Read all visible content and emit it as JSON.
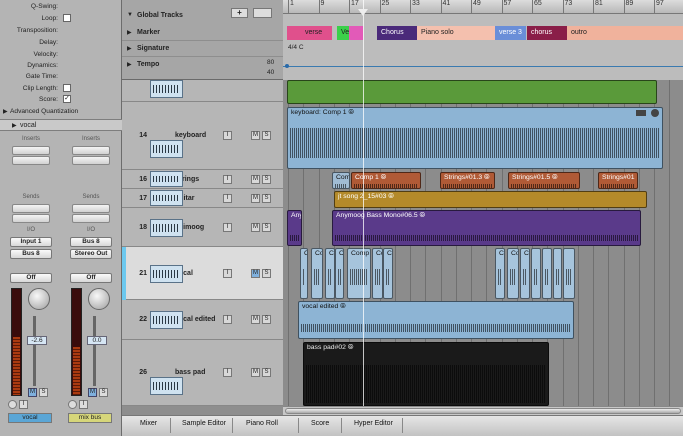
{
  "inspector": {
    "params": [
      {
        "label": "Q-Swing:",
        "value": "",
        "type": "value"
      },
      {
        "label": "Loop:",
        "value": "",
        "type": "check"
      },
      {
        "label": "Transposition:",
        "value": "",
        "type": "stepper"
      },
      {
        "label": "Delay:",
        "value": "",
        "type": "stepper"
      },
      {
        "label": "Velocity:",
        "value": "",
        "type": "value"
      },
      {
        "label": "Dynamics:",
        "value": "",
        "type": "stepper"
      },
      {
        "label": "Gate Time:",
        "value": "",
        "type": "stepper"
      },
      {
        "label": "Clip Length:",
        "value": "",
        "type": "check"
      },
      {
        "label": "Score:",
        "value": "✓",
        "type": "check"
      }
    ],
    "advanced_quantization": "Advanced Quantization",
    "region_name": "vocal",
    "strips": [
      {
        "inserts": "Inserts",
        "sends": "Sends",
        "io": "I/O",
        "input": "Input 1",
        "output": "Bus 8",
        "auto": "Off",
        "fader_value": "-2.6",
        "meter_level": 0.55,
        "name": "vocal",
        "name_color": "#5aa6d6"
      },
      {
        "inserts": "Inserts",
        "sends": "Sends",
        "io": "I/O",
        "input": "Bus 8",
        "output": "Stereo Out",
        "auto": "Off",
        "fader_value": "0.0",
        "meter_level": 0.45,
        "name": "mix bus",
        "name_color": "#d6d67a"
      }
    ]
  },
  "global": {
    "title": "Global Tracks",
    "rows": [
      "Marker",
      "Signature",
      "Tempo"
    ],
    "tempo_hi": "80",
    "tempo_lo": "40",
    "signature": "4/4  C"
  },
  "ruler": [
    "1",
    "9",
    "17",
    "25",
    "33",
    "41",
    "49",
    "57",
    "65",
    "73",
    "81",
    "89",
    "97"
  ],
  "markers": [
    {
      "name": "verse",
      "color": "#e0508c"
    },
    {
      "name": "Verse",
      "color": "#3bd04a"
    },
    {
      "name": "",
      "color": "#e25ab8"
    },
    {
      "name": "Chorus",
      "color": "#4a2a7a"
    },
    {
      "name": "Piano solo",
      "color": "#f4c0ae"
    },
    {
      "name": "verse 3",
      "color": "#6a8ed8"
    },
    {
      "name": "chorus",
      "color": "#8a1e48"
    },
    {
      "name": "outro",
      "color": "#f0b29c"
    }
  ],
  "tracks": [
    {
      "num": "",
      "name": "",
      "mute": false
    },
    {
      "num": "14",
      "name": "keyboard",
      "mute": false
    },
    {
      "num": "16",
      "name": "Strings",
      "mute": false
    },
    {
      "num": "17",
      "name": "guitar",
      "mute": false
    },
    {
      "num": "18",
      "name": "animoog",
      "mute": false
    },
    {
      "num": "21",
      "name": "vocal",
      "mute": true
    },
    {
      "num": "22",
      "name": "vocal edited",
      "mute": false
    },
    {
      "num": "26",
      "name": "bass pad",
      "mute": false
    }
  ],
  "regions": {
    "keyboard": "keyboard: Comp 1 ⦾",
    "strings": [
      "Com",
      "Comp 1 ⦾",
      "Strings#01.3 ⦾",
      "Strings#01.5 ⦾",
      "Strings#01"
    ],
    "guitar": "jt song 2_15#03 ⦾",
    "animoog_a": "Any",
    "animoog_b": "Anymoog Bass Mono#06.5 ⦾",
    "vocal": [
      "C",
      "Co",
      "C",
      "Comp",
      "Comp",
      "Co",
      "Co",
      "Co",
      "Co",
      "Co"
    ],
    "vocal_edited": "vocal edited ⦾",
    "bass_pad": "bass pad#02 ⦾"
  },
  "tabs": [
    "Mixer",
    "Sample Editor",
    "Piano Roll",
    "Score",
    "Hyper Editor"
  ],
  "buttons": {
    "mute": "M",
    "solo": "S",
    "input": "I",
    "plus": "+"
  }
}
